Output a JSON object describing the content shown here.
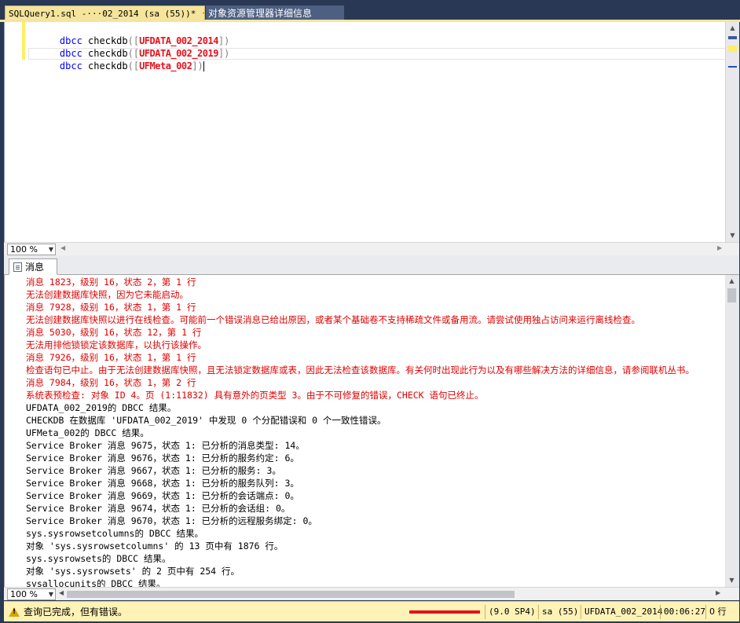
{
  "tabs": {
    "active_label": "SQLQuery1.sql -···02_2014 (sa (55))*",
    "inactive_label": "对象资源管理器详细信息"
  },
  "editor": {
    "lines": [
      {
        "keyword": "dbcc",
        "fn": "checkdb",
        "redacted": "UFDATA_002_2014",
        "close": "])"
      },
      {
        "keyword": "dbcc",
        "fn": "checkdb",
        "redacted": "UFDATA_002_2019",
        "close": "])"
      },
      {
        "keyword": "dbcc",
        "fn": "checkdb",
        "redacted": "UFMeta_002",
        "close": "])"
      }
    ],
    "zoom": "100 %"
  },
  "results": {
    "tab_label": "消息",
    "zoom": "100 %",
    "messages": [
      {
        "type": "err",
        "text": "消息 1823，级别 16，状态 2，第 1 行"
      },
      {
        "type": "err",
        "text": "无法创建数据库快照，因为它未能启动。"
      },
      {
        "type": "err",
        "text": "消息 7928，级别 16，状态 1，第 1 行"
      },
      {
        "type": "err",
        "text": "无法创建数据库快照以进行在线检查。可能前一个错误消息已给出原因，或者某个基础卷不支持稀疏文件或备用流。请尝试使用独占访问来运行离线检查。"
      },
      {
        "type": "err",
        "text": "消息 5030，级别 16，状态 12，第 1 行"
      },
      {
        "type": "err",
        "text": "无法用排他锁锁定该数据库，以执行该操作。"
      },
      {
        "type": "err",
        "text": "消息 7926，级别 16，状态 1，第 1 行"
      },
      {
        "type": "err",
        "text": "检查语句已中止。由于无法创建数据库快照，且无法锁定数据库或表，因此无法检查该数据库。有关何时出现此行为以及有哪些解决方法的详细信息，请参阅联机丛书。"
      },
      {
        "type": "err",
        "text": "消息 7984，级别 16，状态 1，第 2 行"
      },
      {
        "type": "err",
        "text": "系统表预检查: 对象 ID 4。页 (1:11832) 具有意外的页类型 3。由于不可修复的错误，CHECK 语句已终止。"
      },
      {
        "type": "ok",
        "text": "UFDATA_002_2019的 DBCC 结果。"
      },
      {
        "type": "ok",
        "text": "CHECKDB 在数据库 'UFDATA_002_2019' 中发现 0 个分配错误和 0 个一致性错误。"
      },
      {
        "type": "ok",
        "text": "UFMeta_002的 DBCC 结果。"
      },
      {
        "type": "ok",
        "text": "Service Broker 消息 9675，状态 1: 已分析的消息类型: 14。"
      },
      {
        "type": "ok",
        "text": "Service Broker 消息 9676，状态 1: 已分析的服务约定: 6。"
      },
      {
        "type": "ok",
        "text": "Service Broker 消息 9667，状态 1: 已分析的服务: 3。"
      },
      {
        "type": "ok",
        "text": "Service Broker 消息 9668，状态 1: 已分析的服务队列: 3。"
      },
      {
        "type": "ok",
        "text": "Service Broker 消息 9669，状态 1: 已分析的会话端点: 0。"
      },
      {
        "type": "ok",
        "text": "Service Broker 消息 9674，状态 1: 已分析的会话组: 0。"
      },
      {
        "type": "ok",
        "text": "Service Broker 消息 9670，状态 1: 已分析的远程服务绑定: 0。"
      },
      {
        "type": "ok",
        "text": "sys.sysrowsetcolumns的 DBCC 结果。"
      },
      {
        "type": "ok",
        "text": "对象 'sys.sysrowsetcolumns' 的 13 页中有 1876 行。"
      },
      {
        "type": "ok",
        "text": "sys.sysrowsets的 DBCC 结果。"
      },
      {
        "type": "ok",
        "text": "对象 'sys.sysrowsets' 的 2 页中有 254 行。"
      },
      {
        "type": "ok",
        "text": "sysallocunits的 DBCC 结果。"
      }
    ]
  },
  "status": {
    "message": "查询已完成，但有错误。",
    "server_version": "(9.0 SP4)",
    "user": "sa (55)",
    "database": "UFDATA_002_2014",
    "elapsed": "00:06:27",
    "rows": "0 行"
  },
  "colors": {
    "tab_active": "#f5e49c",
    "status_bar": "#fef2b6",
    "error_text": "#e00000",
    "keyword": "#0000ff",
    "frame": "#293955"
  }
}
